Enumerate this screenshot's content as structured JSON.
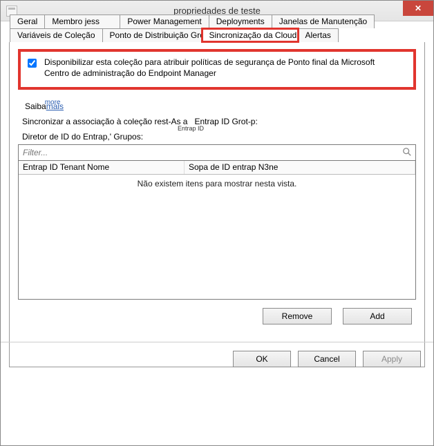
{
  "window": {
    "title": "propriedades de teste",
    "close": "✕"
  },
  "tabs": {
    "row1": [
      {
        "label": "Geral"
      },
      {
        "label": "Membro jess"
      },
      {
        "label": "Power Management"
      },
      {
        "label": "Deployments"
      },
      {
        "label": "Janelas de Manutenção"
      }
    ],
    "row2": [
      {
        "label": "Variáveis de Coleção"
      },
      {
        "label": "Ponto de Distribuição   Groups"
      },
      {
        "label": "Sincronização da Cloud",
        "selected": true,
        "highlight": true
      },
      {
        "label": "Alertas"
      }
    ]
  },
  "checkbox": {
    "checked": true,
    "line1": "Disponibilizar esta coleção para atribuir políticas de segurança de Ponto final da Microsoft",
    "line2": "Centro de administração do Endpoint Manager"
  },
  "learnmore": {
    "prefix": "Saiba",
    "link": "mais",
    "overtype": "more"
  },
  "sync": {
    "label": "Sincronizar a associação à coleção rest-As a",
    "value": "Entrap ID Grot-p:"
  },
  "director": {
    "label": "Diretor de ID do Entrap,' Grupos:",
    "mini": "Entrap ID"
  },
  "filter": {
    "placeholder": "Filter..."
  },
  "grid": {
    "col1": "Entrap ID  Tenant  Nome",
    "col2": "Sopa de ID entrap N3ne",
    "empty": "Não existem itens para mostrar nesta vista."
  },
  "rowbuttons": {
    "remove": "Remove",
    "add": "Add"
  },
  "dialog": {
    "ok": "OK",
    "cancel": "Cancel",
    "apply": "Apply"
  }
}
